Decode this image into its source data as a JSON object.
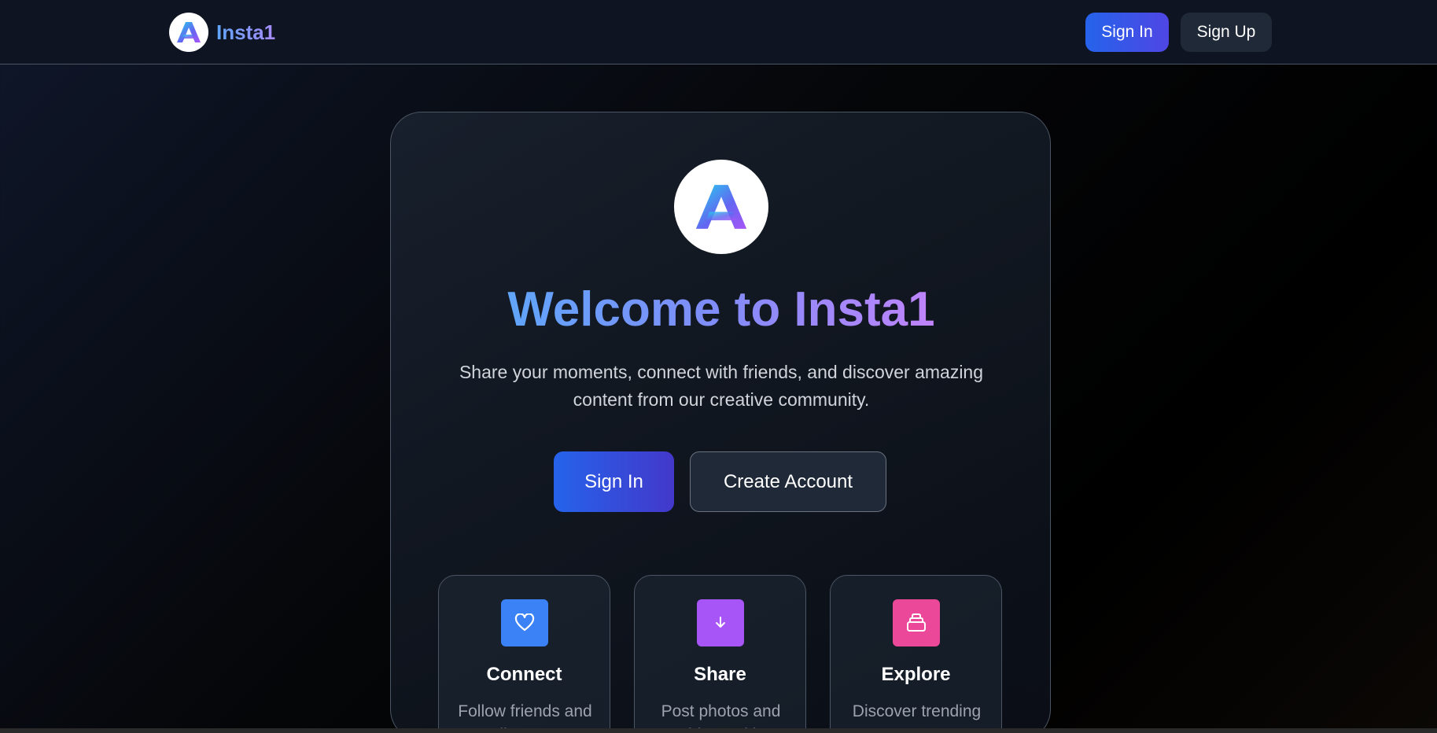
{
  "nav": {
    "brand": "Insta1",
    "sign_in_label": "Sign In",
    "sign_up_label": "Sign Up"
  },
  "hero": {
    "title": "Welcome to Insta1",
    "subtitle": "Share your moments, connect with friends, and discover amazing content from our creative community.",
    "primary_cta": "Sign In",
    "secondary_cta": "Create Account"
  },
  "features": [
    {
      "icon": "heart-icon",
      "color": "#3b82f6",
      "title": "Connect",
      "description": "Follow friends and discover"
    },
    {
      "icon": "download-icon",
      "color": "#a855f7",
      "title": "Share",
      "description": "Post photos and videos with"
    },
    {
      "icon": "stack-icon",
      "color": "#ec4899",
      "title": "Explore",
      "description": "Discover trending content"
    }
  ],
  "colors": {
    "accent_blue": "#2563eb",
    "accent_indigo": "#4f46e5",
    "gradient_start": "#60a5fa",
    "gradient_end": "#c084fc"
  }
}
